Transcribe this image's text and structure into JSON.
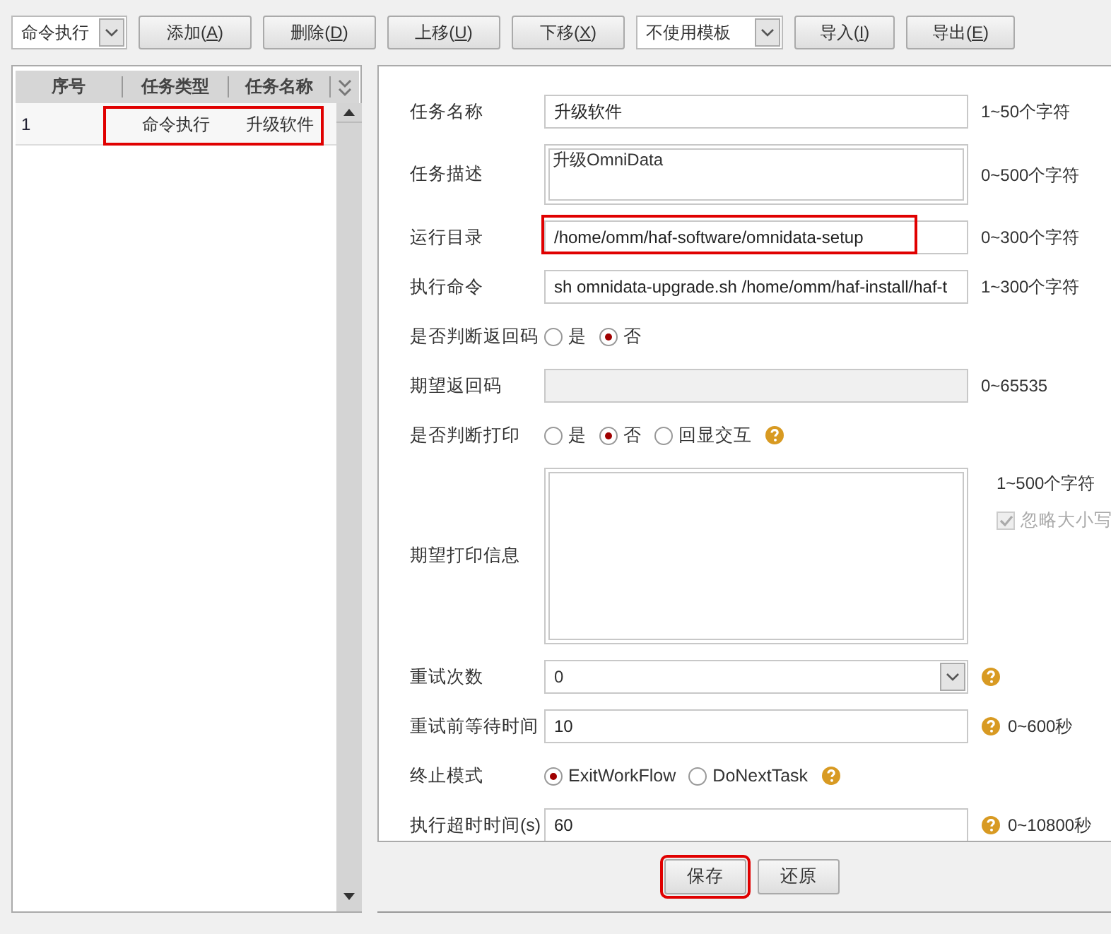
{
  "toolbar": [
    {
      "kind": "select",
      "value": "命令执行"
    },
    {
      "kind": "button",
      "label": "添加(A)",
      "mnemonic": true
    },
    {
      "kind": "button",
      "label": "删除(D)",
      "mnemonic": true
    },
    {
      "kind": "button",
      "label": "上移(U)",
      "mnemonic": true
    },
    {
      "kind": "button",
      "label": "下移(X)",
      "mnemonic": true
    },
    {
      "kind": "select",
      "value": "不使用模板"
    },
    {
      "kind": "button",
      "label": "导入(I)",
      "mnemonic": true
    },
    {
      "kind": "button",
      "label": "导出(E)",
      "mnemonic": true
    }
  ],
  "task_table": {
    "columns": [
      "序号",
      "任务类型",
      "任务名称"
    ],
    "rows": [
      {
        "cells": [
          "1",
          "命令执行",
          "升级软件"
        ],
        "highlighted": true
      }
    ]
  },
  "form": {
    "rows": [
      {
        "kind": "input",
        "label": "任务名称",
        "value": "升级软件",
        "hint": "1~50个字符"
      },
      {
        "kind": "textarea",
        "label": "任务描述",
        "value": "升级OmniData",
        "hint": "0~500个字符"
      },
      {
        "kind": "input",
        "label": "运行目录",
        "value": "/home/omm/haf-software/omnidata-setup",
        "hint": "0~300个字符",
        "highlighted": true
      },
      {
        "kind": "input",
        "label": "执行命令",
        "value": "sh omnidata-upgrade.sh /home/omm/haf-install/haf-t",
        "hint": "1~300个字符"
      },
      {
        "kind": "radio",
        "label": "是否判断返回码",
        "options": [
          {
            "label": "是",
            "selected": false
          },
          {
            "label": "否",
            "selected": true
          }
        ]
      },
      {
        "kind": "input",
        "label": "期望返回码",
        "disabled": true,
        "hint": "0~65535"
      },
      {
        "kind": "radio",
        "label": "是否判断打印",
        "help": true,
        "options": [
          {
            "label": "是",
            "selected": false
          },
          {
            "label": "否",
            "selected": true
          },
          {
            "label": "回显交互",
            "selected": false
          }
        ]
      },
      {
        "kind": "message",
        "label": "期望打印信息",
        "hint": "1~500个字符",
        "checkbox": {
          "label": "忽略大小写",
          "checked": true,
          "disabled": true
        }
      },
      {
        "kind": "select",
        "label": "重试次数",
        "value": "0",
        "help": true
      },
      {
        "kind": "input",
        "label": "重试前等待时间",
        "value": "10",
        "help": true,
        "hint": "0~600秒"
      },
      {
        "kind": "radio",
        "label": "终止模式",
        "help": true,
        "options": [
          {
            "label": "ExitWorkFlow",
            "selected": true
          },
          {
            "label": "DoNextTask",
            "selected": false
          }
        ]
      },
      {
        "kind": "input",
        "label": "执行超时时间(s)",
        "value": "60",
        "help": true,
        "hint": "0~10800秒"
      }
    ]
  },
  "actions": [
    {
      "label": "保存",
      "highlighted": true
    },
    {
      "label": "还原",
      "highlighted": false
    }
  ]
}
